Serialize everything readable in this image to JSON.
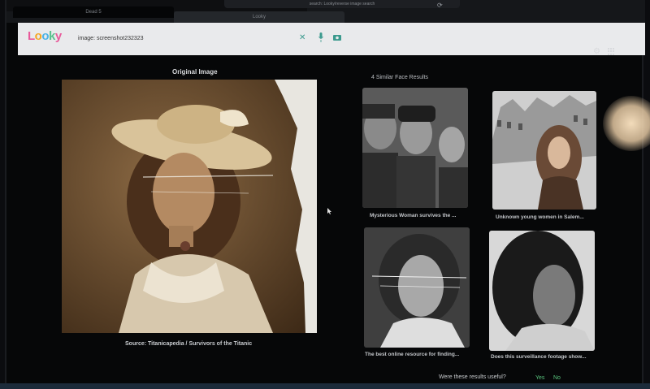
{
  "browser": {
    "tabs": [
      "Dead 5",
      "Looky"
    ],
    "url": "search: Looky/reverse image search"
  },
  "app": {
    "logo": [
      "L",
      "o",
      "o",
      "k",
      "y"
    ],
    "search_value": "image: screenshot232323"
  },
  "original": {
    "title": "Original Image",
    "source": "Source: Titanicapedia / Survivors of the Titanic"
  },
  "results": {
    "title": "4 Similar Face Results",
    "items": [
      {
        "label": "Mysterious Woman survives the ..."
      },
      {
        "label": "Unknown young women in Salem..."
      },
      {
        "label": "The best online resource for finding..."
      },
      {
        "label": "Does this surveillance footage show..."
      }
    ]
  },
  "feedback": {
    "question": "Were these results useful?",
    "yes": "Yes",
    "no": "No"
  },
  "colors": {
    "accent": "#59c47d",
    "sepia": "#6b4f31"
  }
}
